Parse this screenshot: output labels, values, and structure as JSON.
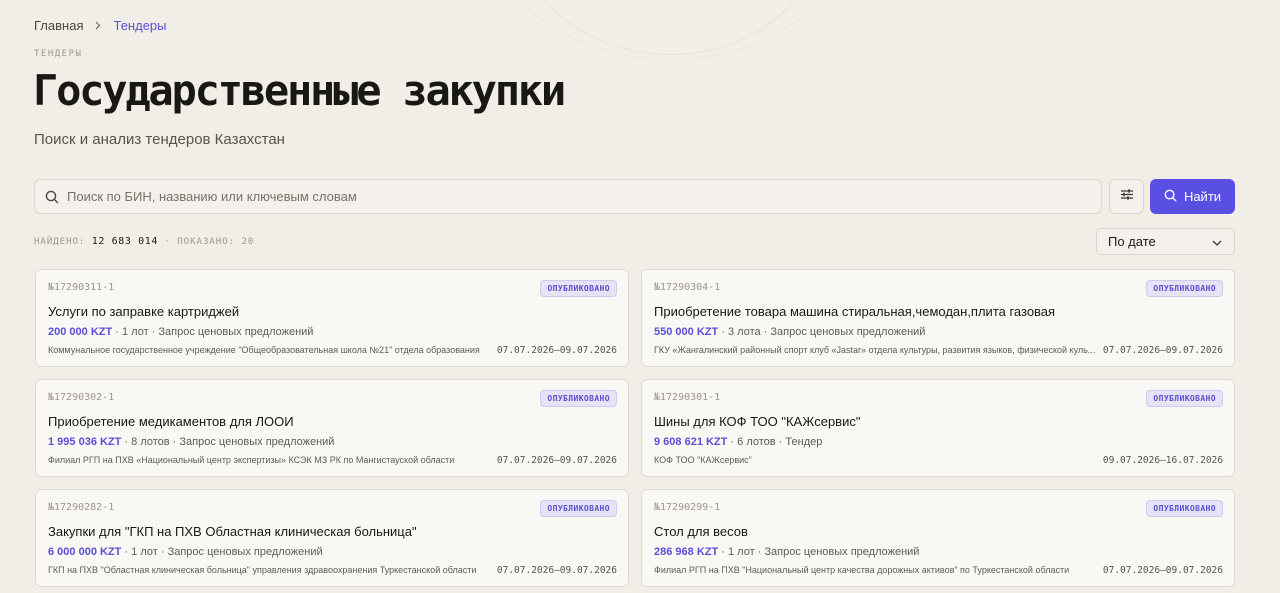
{
  "breadcrumb": {
    "home": "Главная",
    "current": "Тендеры"
  },
  "page": {
    "eyebrow": "ТЕНДЕРЫ",
    "title": "Государственные закупки",
    "subtitle": "Поиск и анализ тендеров Казахстан"
  },
  "search": {
    "placeholder": "Поиск по БИН, названию или ключевым словам",
    "value": "",
    "button_label": "Найти"
  },
  "stats": {
    "found_label": "НАЙДЕНО:",
    "found_value": "12 683 014",
    "separator": "·",
    "shown_label": "ПОКАЗАНО:",
    "shown_value": "20"
  },
  "sort": {
    "selected": "По дате"
  },
  "tenders": [
    {
      "number": "№17290311-1",
      "status": "ОПУБЛИКОВАНО",
      "title": "Услуги по заправке картриджей",
      "price": "200 000 KZT",
      "lots": "1 лот",
      "method": "Запрос ценовых предложений",
      "org": "Коммунальное государственное учреждение \"Общеобразовательная школа №21\" отдела образования",
      "dates": "07.07.2026–09.07.2026"
    },
    {
      "number": "№17290304-1",
      "status": "ОПУБЛИКОВАНО",
      "title": "Приобретение товара машина стиральная,чемодан,плита газовая",
      "price": "550 000 KZT",
      "lots": "3 лота",
      "method": "Запрос ценовых предложений",
      "org": "ГКУ «Жангалинский районный спорт клуб «Jastar» отдела культуры, развития языков, физической культуры",
      "dates": "07.07.2026–09.07.2026"
    },
    {
      "number": "№17290302-1",
      "status": "ОПУБЛИКОВАНО",
      "title": "Приобретение медикаментов для ЛООИ",
      "price": "1 995 036 KZT",
      "lots": "8 лотов",
      "method": "Запрос ценовых предложений",
      "org": "Филиал РГП на ПХВ «Национальный центр экспертизы» КСЭК МЗ РК по Мангистауской области",
      "dates": "07.07.2026–09.07.2026"
    },
    {
      "number": "№17290301-1",
      "status": "ОПУБЛИКОВАНО",
      "title": "Шины для КОФ ТОО \"КАЖсервис\"",
      "price": "9 608 621 KZT",
      "lots": "6 лотов",
      "method": "Тендер",
      "org": "КОФ ТОО \"КАЖсервис\"",
      "dates": "09.07.2026–16.07.2026"
    },
    {
      "number": "№17290282-1",
      "status": "ОПУБЛИКОВАНО",
      "title": "Закупки для \"ГКП на ПХВ Областная клиническая больница\"",
      "price": "6 000 000 KZT",
      "lots": "1 лот",
      "method": "Запрос ценовых предложений",
      "org": "ГКП на ПХВ \"Областная клиническая больница\" управления здравоохранения Туркестанской области",
      "dates": "07.07.2026–09.07.2026"
    },
    {
      "number": "№17290299-1",
      "status": "ОПУБЛИКОВАНО",
      "title": "Стол для весов",
      "price": "286 968 KZT",
      "lots": "1 лот",
      "method": "Запрос ценовых предложений",
      "org": "Филиал РГП на ПХВ \"Национальный центр качества дорожных активов\" по Туркестанской области",
      "dates": "07.07.2026–09.07.2026"
    }
  ]
}
